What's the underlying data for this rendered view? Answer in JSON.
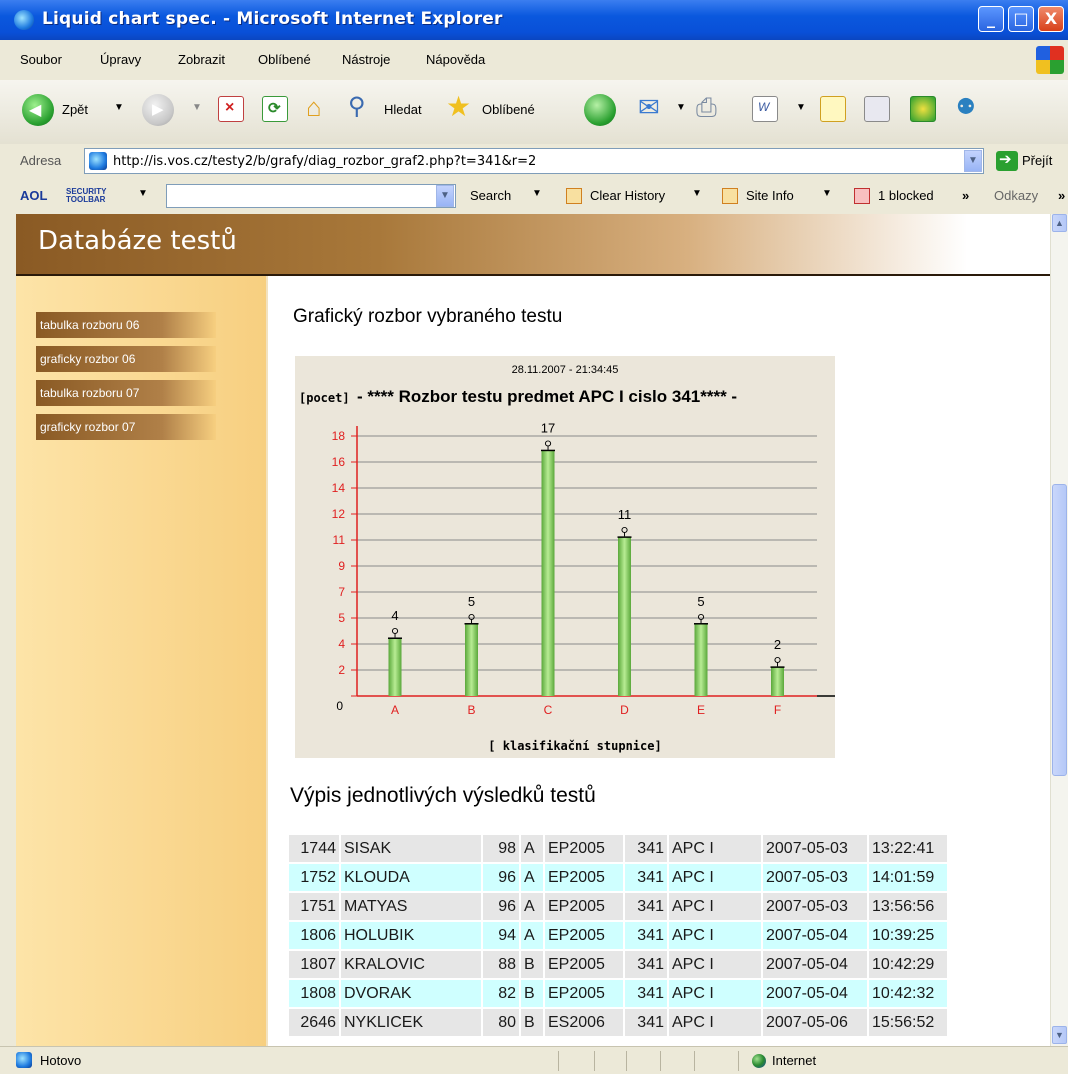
{
  "window": {
    "title": "Liquid chart spec. - Microsoft Internet Explorer",
    "controls": {
      "minimize": "_",
      "maximize": "□",
      "close": "X"
    }
  },
  "menu": [
    "Soubor",
    "Úpravy",
    "Zobrazit",
    "Oblíbené",
    "Nástroje",
    "Nápověda"
  ],
  "toolbar": {
    "back_label": "Zpět",
    "search_label": "Hledat",
    "favorites_label": "Oblíbené"
  },
  "address": {
    "label": "Adresa",
    "url": "http://is.vos.cz/testy2/b/grafy/diag_rozbor_graf2.php?t=341&r=2",
    "go_label": "Přejít"
  },
  "aol_toolbar": {
    "brand": "AOL",
    "security": "SECURITY TOOLBAR",
    "search_label": "Search",
    "clear_history": "Clear History",
    "site_info": "Site Info",
    "blocked": "1 blocked",
    "links_label": "Odkazy"
  },
  "page": {
    "banner_title": "Databáze testů",
    "sidebar": [
      {
        "label": "tabulka rozboru 06"
      },
      {
        "label": "graficky rozbor 06"
      },
      {
        "label": "tabulka rozboru 07"
      },
      {
        "label": "graficky rozbor 07"
      }
    ],
    "main_title": "Grafický rozbor vybraného testu",
    "results_title": "Výpis jednotlivých výsledků testů"
  },
  "chart_data": {
    "type": "bar",
    "timestamp": "28.11.2007 - 21:34:45",
    "ylabel": "[pocet]",
    "title": "- **** Rozbor testu predmet APC I cislo 341**** -",
    "xlabel": "[ klasifikační stupnice]",
    "categories": [
      "A",
      "B",
      "C",
      "D",
      "E",
      "F"
    ],
    "values": [
      4,
      5,
      17,
      11,
      5,
      2
    ],
    "yticks": [
      "0",
      "2",
      "4",
      "5",
      "7",
      "9",
      "11",
      "12",
      "14",
      "16",
      "18"
    ],
    "ylim": [
      0,
      18
    ],
    "grid": true,
    "colors": {
      "bar": "#7cc45a",
      "axis": "#e02020",
      "tick_label": "#e02020"
    }
  },
  "results": [
    {
      "id": "1744",
      "name": "SISAK",
      "score": "98",
      "grade": "A",
      "group": "EP2005",
      "test": "341",
      "subject": "APC I",
      "date": "2007-05-03",
      "time": "13:22:41"
    },
    {
      "id": "1752",
      "name": "KLOUDA",
      "score": "96",
      "grade": "A",
      "group": "EP2005",
      "test": "341",
      "subject": "APC I",
      "date": "2007-05-03",
      "time": "14:01:59"
    },
    {
      "id": "1751",
      "name": "MATYAS",
      "score": "96",
      "grade": "A",
      "group": "EP2005",
      "test": "341",
      "subject": "APC I",
      "date": "2007-05-03",
      "time": "13:56:56"
    },
    {
      "id": "1806",
      "name": "HOLUBIK",
      "score": "94",
      "grade": "A",
      "group": "EP2005",
      "test": "341",
      "subject": "APC I",
      "date": "2007-05-04",
      "time": "10:39:25"
    },
    {
      "id": "1807",
      "name": "KRALOVIC",
      "score": "88",
      "grade": "B",
      "group": "EP2005",
      "test": "341",
      "subject": "APC I",
      "date": "2007-05-04",
      "time": "10:42:29"
    },
    {
      "id": "1808",
      "name": "DVORAK",
      "score": "82",
      "grade": "B",
      "group": "EP2005",
      "test": "341",
      "subject": "APC I",
      "date": "2007-05-04",
      "time": "10:42:32"
    },
    {
      "id": "2646",
      "name": "NYKLICEK",
      "score": "80",
      "grade": "B",
      "group": "ES2006",
      "test": "341",
      "subject": "APC I",
      "date": "2007-05-06",
      "time": "15:56:52"
    }
  ],
  "status": {
    "left": "Hotovo",
    "zone": "Internet"
  }
}
